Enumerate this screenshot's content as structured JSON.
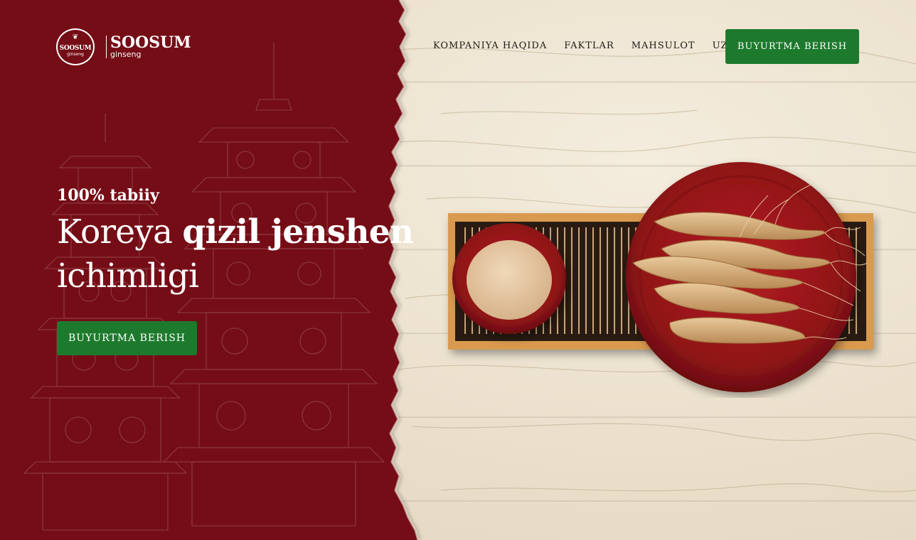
{
  "brand": {
    "name": "SOOSUM",
    "subname": "ginseng",
    "seal_name": "SOOSUM",
    "seal_sub": "ginseng"
  },
  "nav": {
    "items": [
      "KOMPANIYA HAQIDA",
      "FAKTLAR",
      "MAHSULOT",
      "UZ"
    ],
    "cta": "BUYURTMA BERISH"
  },
  "hero": {
    "tag": "100% tabiiy",
    "title_part1": "Koreya ",
    "title_bold": "qizil jenshen",
    "title_part2": "ichimligi",
    "cta": "BUYURTMA BERISH"
  },
  "colors": {
    "brand_red": "#740a14",
    "cta_green": "#1d7a2d",
    "wood": "#efe6d6"
  }
}
